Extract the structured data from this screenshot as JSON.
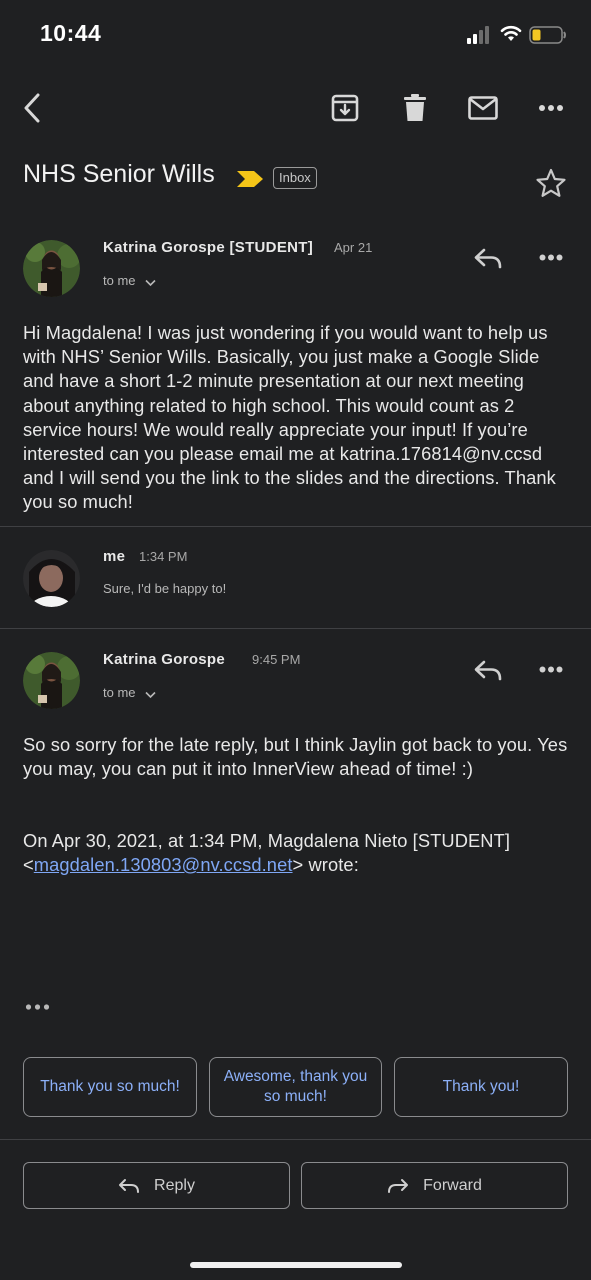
{
  "status_bar": {
    "time": "10:44",
    "icons": [
      "cellular-signal-icon",
      "wifi-icon",
      "battery-low-icon"
    ],
    "battery_color": "#f3c623"
  },
  "toolbar": {
    "icons": [
      "back-icon",
      "archive-icon",
      "delete-icon",
      "mark-unread-icon",
      "more-icon"
    ]
  },
  "subject": {
    "title": "NHS Senior Wills",
    "label": "Inbox",
    "importance_color": "#f5c518"
  },
  "messages": [
    {
      "sender": "Katrina Gorospe [STUDENT]",
      "date": "Apr 21",
      "to": "to me",
      "body": "Hi Magdalena! I was just wondering if you would want to help us with NHS’ Senior Wills. Basically, you just make a Google Slide and have a short 1-2 minute presentation at our next meeting about anything related to high school. This would count as 2 service hours! We would really appreciate your input! If you’re interested can you please email me at katrina.176814@nv.ccsd and I will send you the link to the slides and the directions. Thank you so much!"
    },
    {
      "sender": "me",
      "date": "1:34 PM",
      "snippet": "Sure, I'd be happy to!"
    },
    {
      "sender": "Katrina Gorospe",
      "date": "9:45 PM",
      "to": "to me",
      "body_p1": "So so sorry for the late reply, but I think Jaylin got back to you. Yes you may, you can put it into InnerView ahead of time! :)",
      "quote_intro": "On Apr 30, 2021, at 1:34 PM, Magdalena Nieto [STUDENT]",
      "quote_lt": "<",
      "quote_email": "magdalen.130803@nv.ccsd.net",
      "quote_suffix": "> wrote:"
    }
  ],
  "smart_replies": [
    "Thank you so much!",
    "Awesome, thank you so much!",
    "Thank you!"
  ],
  "actions": {
    "reply": "Reply",
    "forward": "Forward"
  },
  "accent_link_color": "#7fa7f5"
}
